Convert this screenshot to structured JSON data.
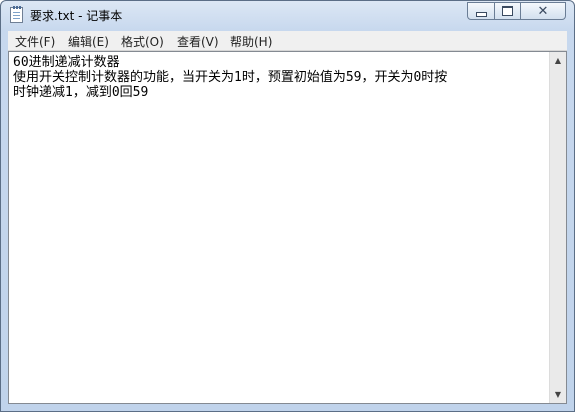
{
  "window": {
    "title": "要求.txt - 记事本"
  },
  "menu": {
    "items": [
      "文件(F)",
      "编辑(E)",
      "格式(O)",
      "查看(V)",
      "帮助(H)"
    ]
  },
  "document": {
    "lines": [
      "60进制递减计数器",
      "使用开关控制计数器的功能，当开关为1时，预置初始值为59，开关为0时按",
      "时钟递减1，减到0回59"
    ]
  },
  "icons": {
    "app": "notepad-icon",
    "minimize": "minimize-icon",
    "maximize": "maximize-icon",
    "close": "close-icon",
    "scroll_up": "scroll-up-arrow-icon",
    "scroll_down": "scroll-down-arrow-icon"
  },
  "colors": {
    "titlebar": "#c7d8ee",
    "menubar": "#f0f0f0",
    "editor_bg": "#ffffff",
    "text": "#000000"
  }
}
